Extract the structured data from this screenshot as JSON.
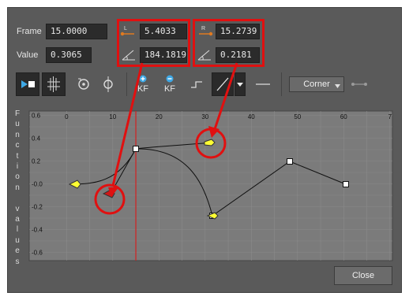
{
  "fields": {
    "frame_label": "Frame",
    "frame_value": "15.0000",
    "value_label": "Value",
    "value_value": "0.3065",
    "left_handle_value": "5.4033",
    "left_angle_value": "184.1819",
    "right_handle_value": "15.2739",
    "right_angle_value": "0.2181"
  },
  "toolbar": {
    "keyframe_plus_label": "KF",
    "keyframe_minus_label": "KF",
    "interpolation_select": "Corner"
  },
  "graph": {
    "axis_title": "Function values",
    "y_ticks": [
      "0.6",
      "0.4",
      "0.2",
      "-0.0",
      "-0.2",
      "-0.4",
      "-0.6"
    ],
    "x_ticks": [
      "0",
      "10",
      "20",
      "30",
      "40",
      "50",
      "60",
      "7"
    ],
    "playhead_frame": 15
  },
  "buttons": {
    "close_label": "Close"
  },
  "colors": {
    "panel": "#5a5a5a",
    "graph_bg": "#7b7b7b",
    "annotation_red": "#e01010",
    "playhead_red": "#d32020",
    "handle_yellow": "#ffff33",
    "handle_red": "#d01818",
    "accent_blue": "#3fa9e6"
  }
}
